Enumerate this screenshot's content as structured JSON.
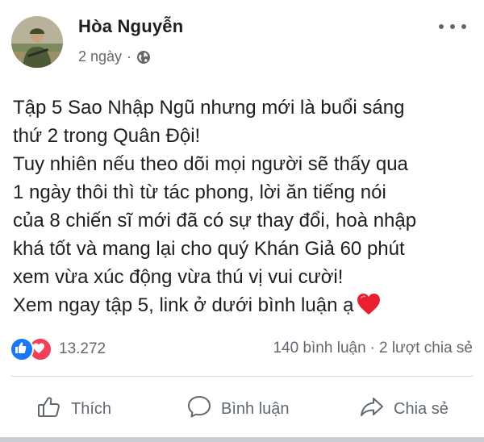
{
  "post": {
    "author": "Hòa Nguyễn",
    "time": "2 ngày",
    "time_separator": "·",
    "privacy_icon": "globe-icon",
    "text_lines": [
      "Tập 5 Sao Nhập Ngũ nhưng mới là buổi sáng",
      "thứ 2 trong Quân Đội!",
      "Tuy nhiên nếu theo dõi mọi người sẽ thấy qua",
      "1 ngày thôi thì từ tác phong, lời ăn tiếng nói",
      "của 8 chiến sĩ mới đã có sự thay đổi, hoà nhập",
      "khá tốt và mang lại cho quý Khán Giả 60 phút",
      "xem vừa xúc động vừa thú vị vui cười!",
      "Xem ngay tập 5, link ở dưới bình luận ạ"
    ],
    "heart_emoji_color": "#e8202f"
  },
  "reactions": {
    "count": "13.272",
    "icons": [
      "like-icon",
      "love-icon"
    ]
  },
  "stats": {
    "comments": "140 bình luận",
    "separator": "·",
    "shares": "2 lượt chia sẻ"
  },
  "actions": {
    "like": "Thích",
    "comment": "Bình luận",
    "share": "Chia sẻ"
  },
  "colors": {
    "like_blue": "#1877f2",
    "love_red": "#f33e58",
    "secondary_text": "#65676b"
  }
}
